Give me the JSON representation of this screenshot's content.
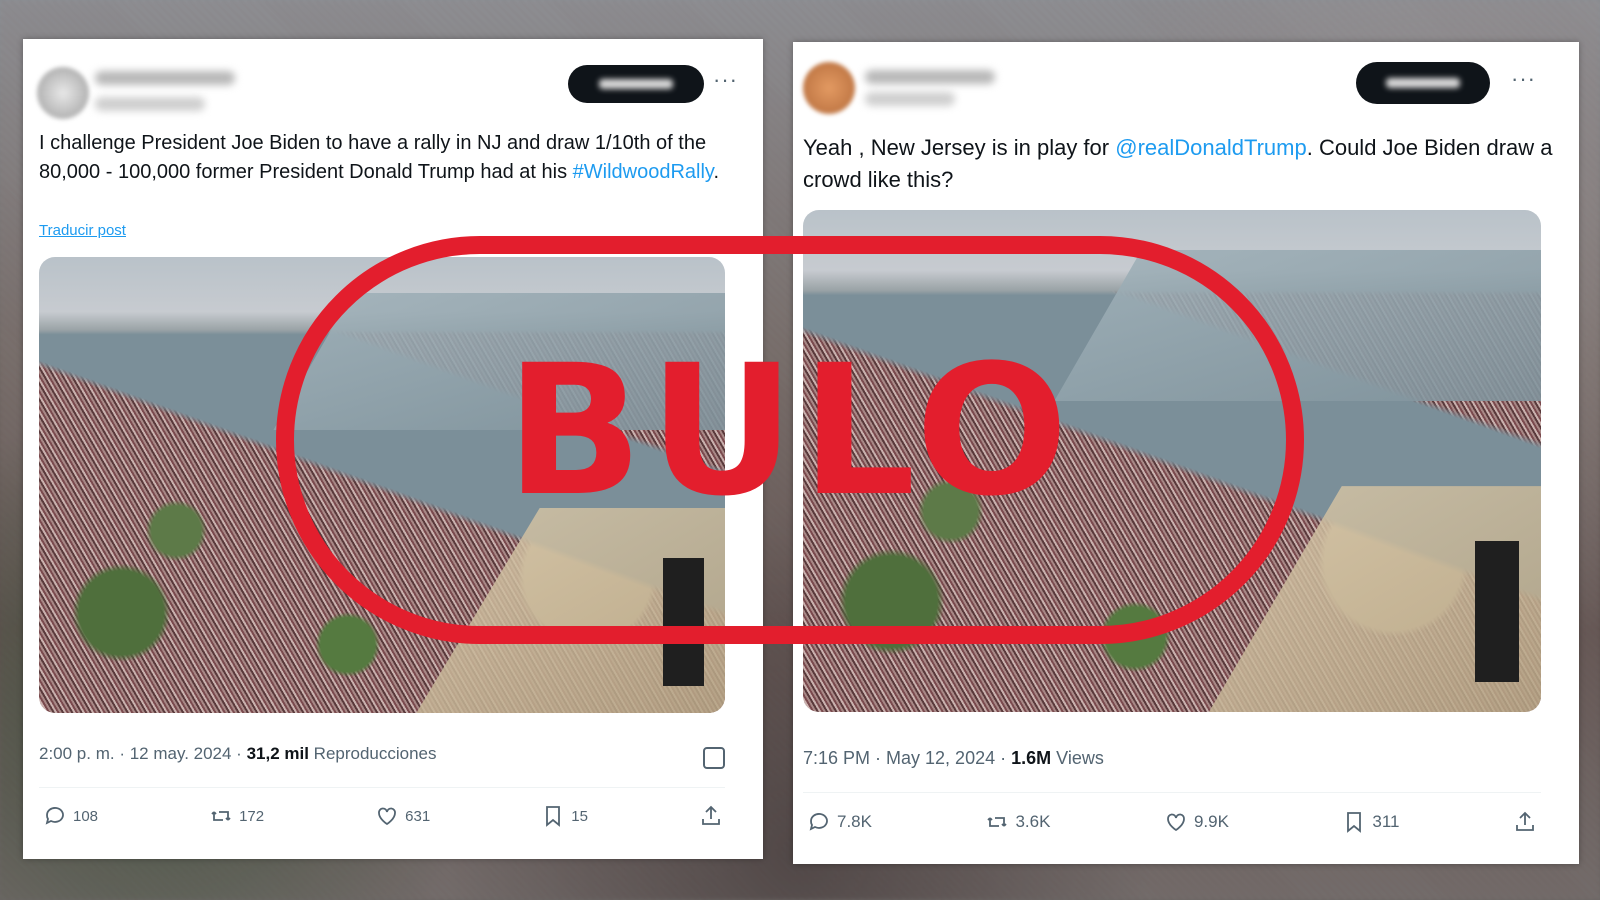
{
  "left_post": {
    "text_before": "I challenge President Joe Biden to have a rally in NJ and draw 1/10th of the 80,000 - 100,000 former President Donald Trump had at his ",
    "hashtag": "#WildwoodRally",
    "text_after": ".",
    "translate_label": "Traducir post",
    "time": "2:00 p. m. · 12 may. 2024 · ",
    "views_count": "31,2 mil",
    "views_label": " Reproducciones",
    "replies": "108",
    "reposts": "172",
    "likes": "631",
    "bookmarks": "15"
  },
  "right_post": {
    "text_before": "Yeah , New Jersey is in play for ",
    "mention": "@realDonaldTrump",
    "text_after": ". Could Joe Biden draw a crowd like this?",
    "time": "7:16 PM · May 12, 2024 · ",
    "views_count": "1.6M",
    "views_label": " Views",
    "replies": "7.8K",
    "reposts": "3.6K",
    "likes": "9.9K",
    "bookmarks": "311"
  },
  "stamp": {
    "label": "BULO",
    "color": "#e31e2d"
  },
  "icons": [
    "reply-icon",
    "repost-icon",
    "like-icon",
    "bookmark-icon",
    "share-icon",
    "more-icon",
    "grok-icon"
  ],
  "colors": {
    "link": "#1d9bf0",
    "text": "#0f1419",
    "muted": "#536471"
  }
}
